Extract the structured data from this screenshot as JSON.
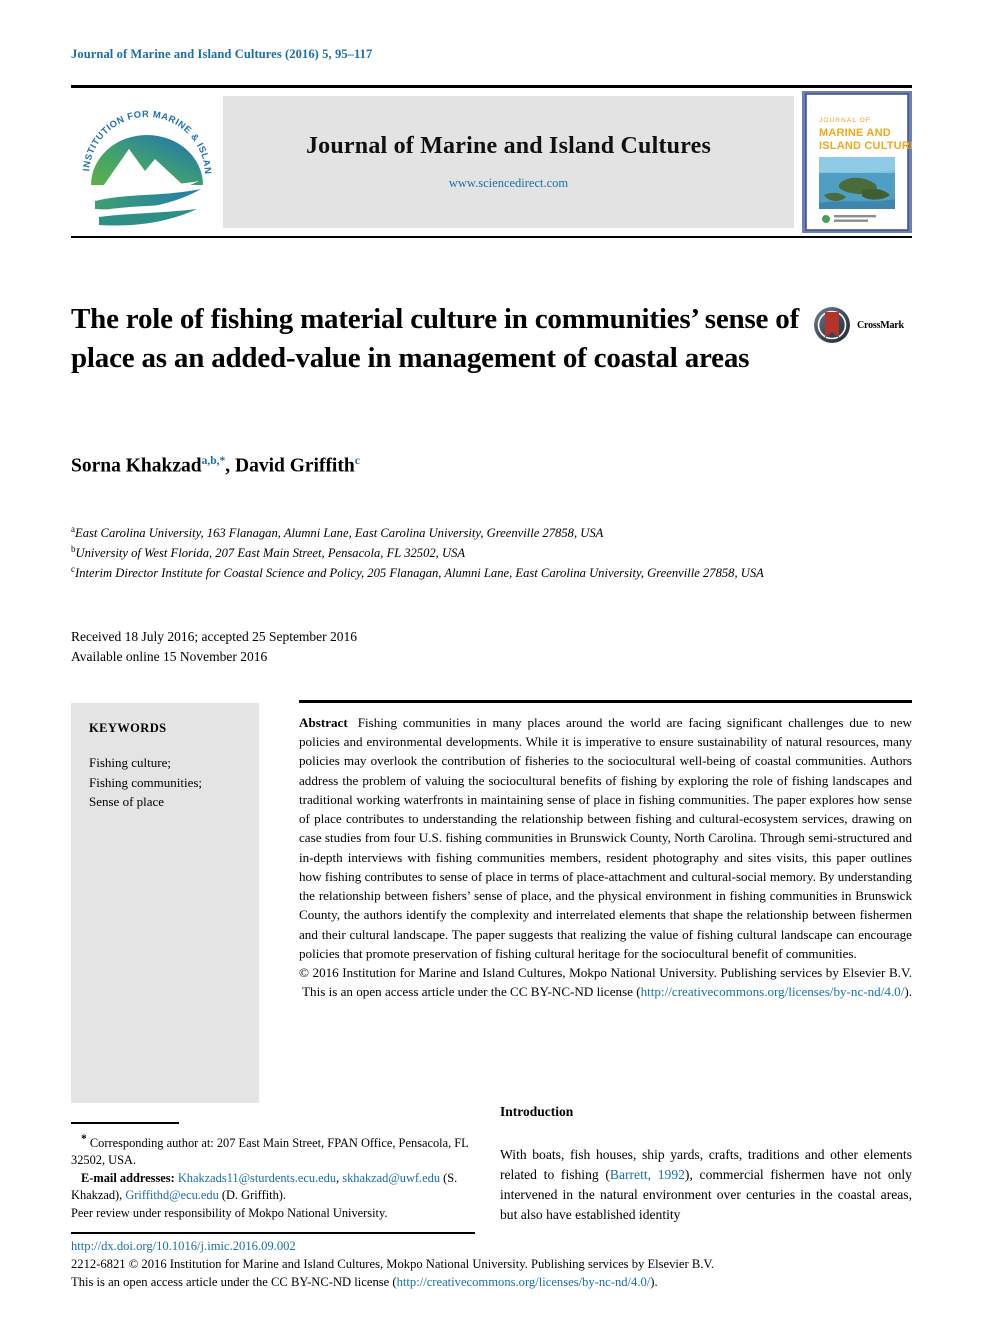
{
  "running_head": "Journal of Marine and Island Cultures (2016) 5, 95–117",
  "masthead": {
    "logo_ring_text": "INSTITUTION FOR MARINE & ISLAND CULTURES",
    "journal_title": "Journal of Marine and Island Cultures",
    "journal_url": "www.sciencedirect.com",
    "cover": {
      "line1": "JOURNAL OF",
      "line2": "MARINE AND",
      "line3": "ISLAND CULTURES"
    }
  },
  "article": {
    "title": "The role of fishing material culture in communities’ sense of place as an added-value in management of coastal areas",
    "crossmark_label": "CrossMark",
    "authors": [
      {
        "name": "Sorna Khakzad",
        "marks": "a,b,*"
      },
      {
        "name": "David Griffith",
        "marks": "c"
      }
    ],
    "authors_line": "Sorna Khakzad a,b,*, David Griffith c",
    "affiliations": [
      {
        "mark": "a",
        "text": "East Carolina University, 163 Flanagan, Alumni Lane, East Carolina University, Greenville 27858, USA"
      },
      {
        "mark": "b",
        "text": "University of West Florida, 207 East Main Street, Pensacola, FL 32502, USA"
      },
      {
        "mark": "c",
        "text": "Interim Director Institute for Coastal Science and Policy, 205 Flanagan, Alumni Lane, East Carolina University, Greenville 27858, USA"
      }
    ],
    "dates": {
      "received": "Received 18 July 2016; accepted 25 September 2016",
      "available": "Available online 15 November 2016"
    }
  },
  "keywords": {
    "heading": "KEYWORDS",
    "items": [
      "Fishing culture;",
      "Fishing communities;",
      "Sense of place"
    ]
  },
  "abstract": {
    "label": "Abstract",
    "text": "Fishing communities in many places around the world are facing significant challenges due to new policies and environmental developments. While it is imperative to ensure sustainability of natural resources, many policies may overlook the contribution of fisheries to the sociocultural well-being of coastal communities. Authors address the problem of valuing the sociocultural benefits of fishing by exploring the role of fishing landscapes and traditional working waterfronts in maintaining sense of place in fishing communities. The paper explores how sense of place contributes to understanding the relationship between fishing and cultural-ecosystem services, drawing on case studies from four U.S. fishing communities in Brunswick County, North Carolina. Through semi-structured and in-depth interviews with fishing communities members, resident photography and sites visits, this paper outlines how fishing contributes to sense of place in terms of place-attachment and cultural-social memory. By understanding the relationship between fishers’ sense of place, and the physical environment in fishing communities in Brunswick County, the authors identify the complexity and interrelated elements that shape the relationship between fishermen and their cultural landscape. The paper suggests that realizing the value of fishing cultural landscape can encourage policies that promote preservation of fishing cultural heritage for the sociocultural benefit of communities.",
    "copyright_prefix": "© 2016 Institution for Marine and Island Cultures, Mokpo National University. Publishing services by Elsevier B.V. This is an open access article under the CC BY-NC-ND license (",
    "copyright_link": "http://creativecommons.org/licenses/by-nc-nd/4.0/",
    "copyright_suffix": ")."
  },
  "footnote": {
    "corresponding_mark": "*",
    "corresponding": "Corresponding author at: 207 East Main Street, FPAN Office, Pensacola, FL 32502, USA.",
    "email_label": "E-mail addresses:",
    "email_1": "Khakzads11@sturdents.ecu.edu",
    "email_sep_1": ", ",
    "email_2": "skhakzad@uwf.edu",
    "email_2_name": " (S. Khakzad), ",
    "email_3": "Griffithd@ecu.edu",
    "email_3_name": " (D. Griffith).",
    "peer_review": "Peer review under responsibility of Mokpo National University."
  },
  "introduction": {
    "heading": "Introduction",
    "part1": "With boats, fish houses, ship yards, crafts, traditions and other elements related to fishing (",
    "citation": "Barrett, 1992",
    "part2": "), commercial fishermen have not only intervened in the natural environment over centuries in the coastal areas, but also have established identity"
  },
  "footer": {
    "doi": "http://dx.doi.org/10.1016/j.imic.2016.09.002",
    "line1": "2212-6821 © 2016 Institution for Marine and Island Cultures, Mokpo National University. Publishing services by Elsevier B.V.",
    "line2_prefix": "This is an open access article under the CC BY-NC-ND license (",
    "line2_link": "http://creativecommons.org/licenses/by-nc-nd/4.0/",
    "line2_suffix": ")."
  },
  "colors": {
    "link": "#1a6ea8",
    "panel": "#e4e4e4",
    "logo_green": "#4ba23c",
    "logo_blue": "#1f6fb5",
    "cover_orange": "#e8a020",
    "crossmark_red": "#b4342a"
  }
}
